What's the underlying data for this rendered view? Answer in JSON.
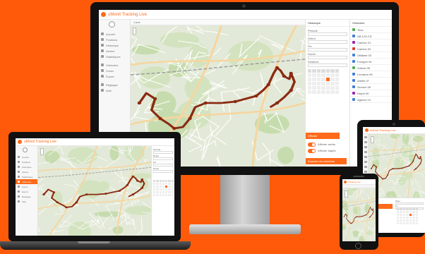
{
  "app": {
    "title": "uMonit Tracking Live",
    "title_short": "Tracking Live",
    "accent": "#ff6a1a",
    "background": "#ff5a0a",
    "track_color": "#8b2a12"
  },
  "monitor": {
    "sidebar_items": [
      "Accueil",
      "Positions",
      "Historique",
      "Alertes",
      "Statistiques",
      "",
      "Véhicules",
      "Zones",
      "Export",
      "",
      "Réglages",
      "Aide"
    ],
    "sidebar_active_index": -1,
    "map_tab": "Carte",
    "panel_title": "Historique",
    "panel_labels": [
      "Période",
      "Début",
      "Fin",
      "Durée",
      "Distance"
    ],
    "date_selected": "12",
    "button_primary": "Afficher",
    "button_secondary": "Exporter les données",
    "toggles": [
      "Afficher arrêts",
      "Afficher trajets"
    ],
    "device_list_title": "Véhicules",
    "devices": [
      {
        "name": "Tous",
        "color": "#4caf50"
      },
      {
        "name": "AB-123-CD",
        "color": "#3f7fd8"
      },
      {
        "name": "Camion 01",
        "color": "#9c27b0"
      },
      {
        "name": "Camion 02",
        "color": "#e53935"
      },
      {
        "name": "Utilitaire 03",
        "color": "#3f7fd8"
      },
      {
        "name": "Fourgon 04",
        "color": "#3f7fd8"
      },
      {
        "name": "Voiture 05",
        "color": "#4caf50"
      },
      {
        "name": "Livraison 06",
        "color": "#3f7fd8"
      },
      {
        "name": "Atelier 07",
        "color": "#3f7fd8"
      },
      {
        "name": "Service 08",
        "color": "#3f7fd8"
      },
      {
        "name": "Dépôt 09",
        "color": "#9c27b0"
      },
      {
        "name": "Agence 10",
        "color": "#3f7fd8"
      }
    ]
  },
  "laptop": {
    "sidebar_items": [
      "Accueil",
      "Positions",
      "Historique",
      "Alertes",
      "Statistiques",
      "Véhicules",
      "Zones",
      "Export",
      "Réglages",
      "Aide"
    ],
    "sidebar_active_index": 5,
    "panel_labels": [
      "Période",
      "Début",
      "Fin",
      "Durée"
    ]
  },
  "tablet": {
    "panel_labels": [
      "Début",
      "Fin"
    ]
  },
  "phone": {}
}
